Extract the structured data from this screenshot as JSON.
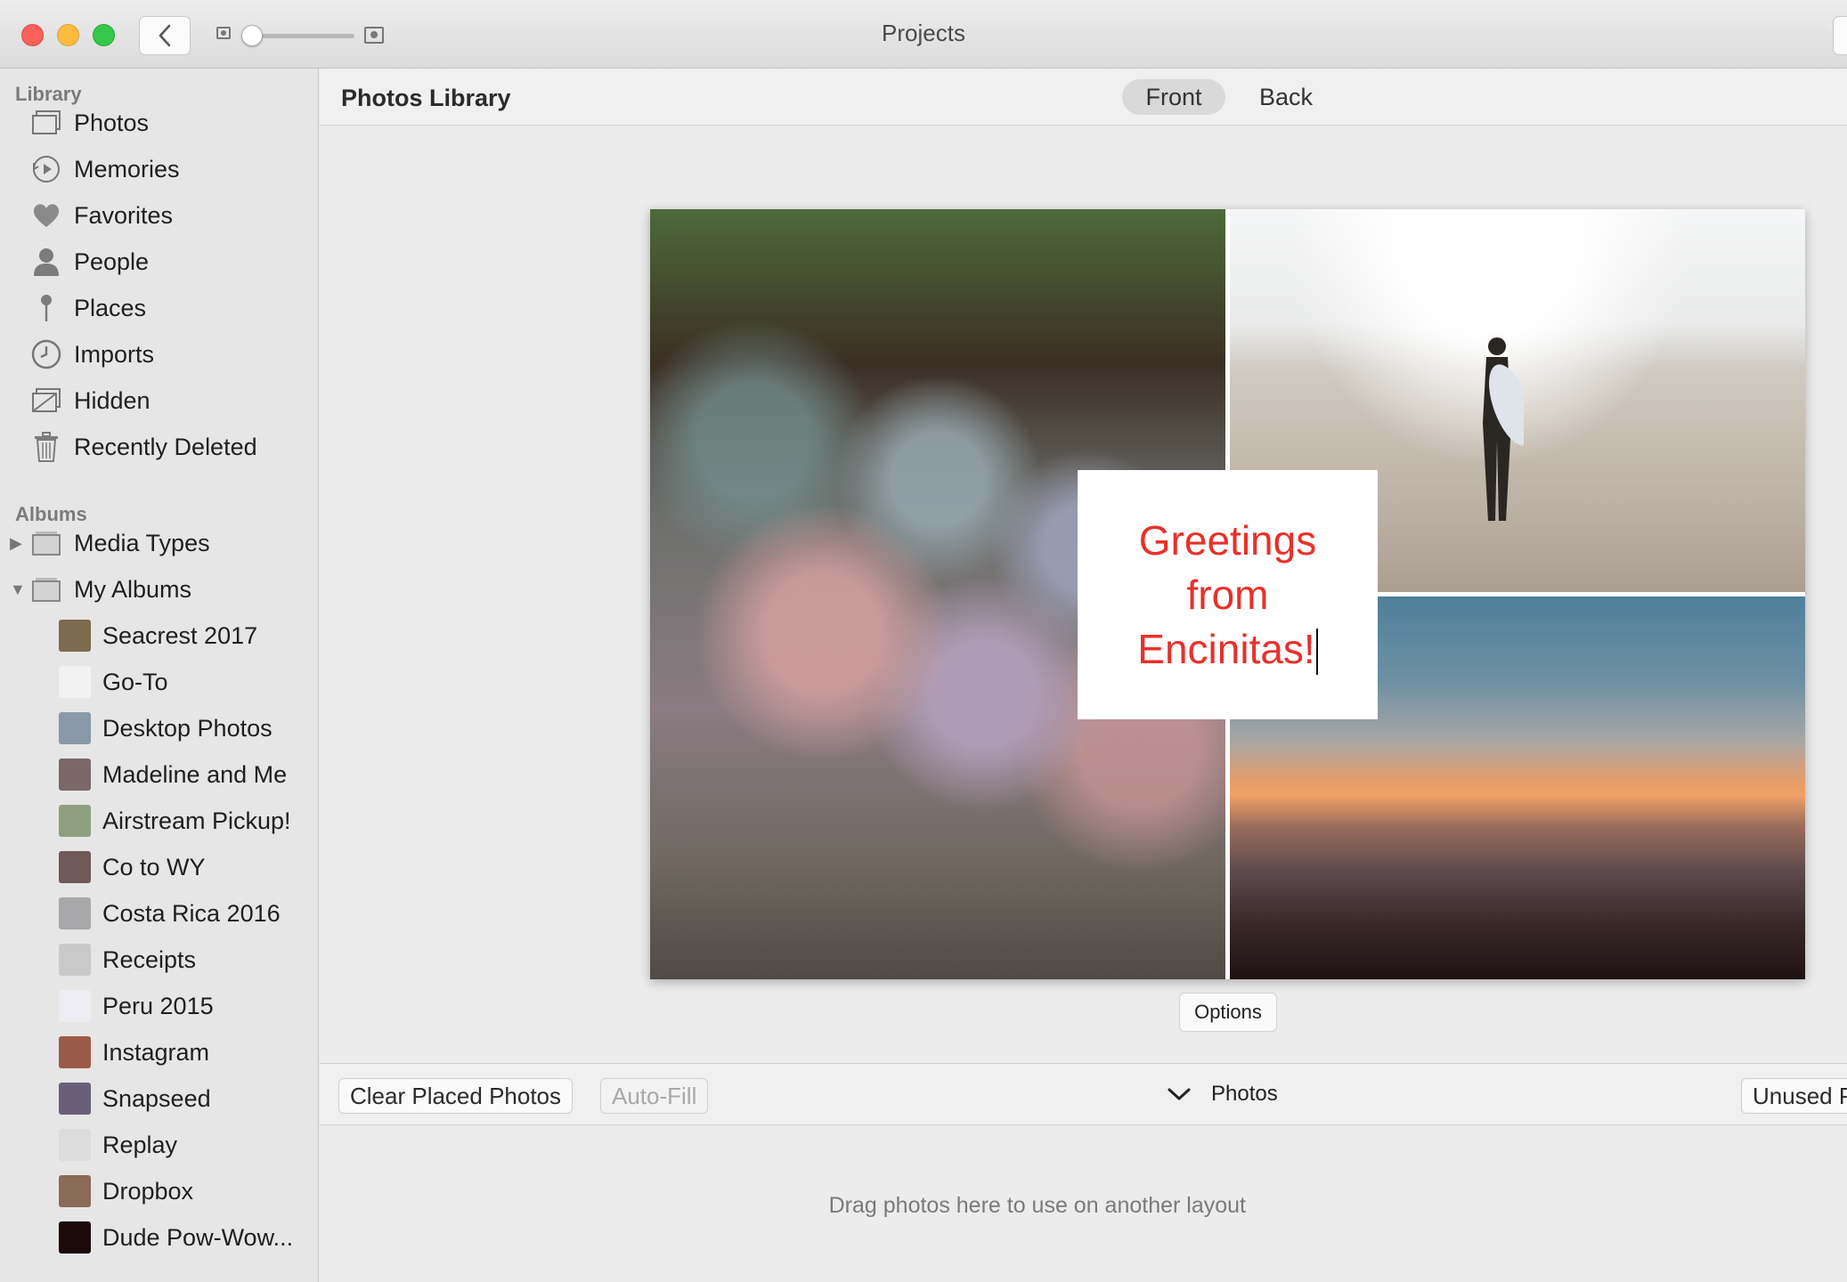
{
  "window": {
    "title": "Projects"
  },
  "sidebar": {
    "library_label": "Library",
    "library_items": [
      {
        "label": "Photos",
        "icon": "photos-icon"
      },
      {
        "label": "Memories",
        "icon": "memories-icon"
      },
      {
        "label": "Favorites",
        "icon": "heart-icon"
      },
      {
        "label": "People",
        "icon": "person-icon"
      },
      {
        "label": "Places",
        "icon": "pin-icon"
      },
      {
        "label": "Imports",
        "icon": "clock-icon"
      },
      {
        "label": "Hidden",
        "icon": "hidden-icon"
      },
      {
        "label": "Recently Deleted",
        "icon": "trash-icon"
      }
    ],
    "albums_label": "Albums",
    "album_groups": [
      {
        "label": "Media Types",
        "expanded": false
      },
      {
        "label": "My Albums",
        "expanded": true
      }
    ],
    "albums": [
      {
        "label": "Seacrest 2017",
        "thumb_color": "#7d6a4f"
      },
      {
        "label": "Go-To",
        "thumb_color": "#f2f2f2"
      },
      {
        "label": "Desktop Photos",
        "thumb_color": "#8a98a8"
      },
      {
        "label": "Madeline and Me",
        "thumb_color": "#7a6868"
      },
      {
        "label": "Airstream Pickup!",
        "thumb_color": "#8fa080"
      },
      {
        "label": "Co to WY",
        "thumb_color": "#6e5a58"
      },
      {
        "label": "Costa Rica 2016",
        "thumb_color": "#a8a8aa"
      },
      {
        "label": "Receipts",
        "thumb_color": "#c9c9c9"
      },
      {
        "label": "Peru 2015",
        "thumb_color": "#ececf2"
      },
      {
        "label": "Instagram",
        "thumb_color": "#9a5a48"
      },
      {
        "label": "Snapseed",
        "thumb_color": "#6a5f78"
      },
      {
        "label": "Replay",
        "thumb_color": "#dcdcdc"
      },
      {
        "label": "Dropbox",
        "thumb_color": "#8a6a58"
      },
      {
        "label": "Dude Pow-Wow...",
        "thumb_color": "#1a0a0a"
      }
    ]
  },
  "header": {
    "library_title": "Photos Library",
    "tabs": [
      {
        "label": "Front",
        "selected": true
      },
      {
        "label": "Back",
        "selected": false
      }
    ]
  },
  "card": {
    "greeting_line1": "Greetings",
    "greeting_line2": "from",
    "greeting_line3": "Encinitas!",
    "text_color": "#e8312a"
  },
  "options_label": "Options",
  "bottom_bar": {
    "clear_label": "Clear Placed Photos",
    "autofill_label": "Auto-Fill",
    "photos_label": "Photos",
    "unused_label": "Unused P"
  },
  "drop_zone_text": "Drag photos here to use on another layout"
}
